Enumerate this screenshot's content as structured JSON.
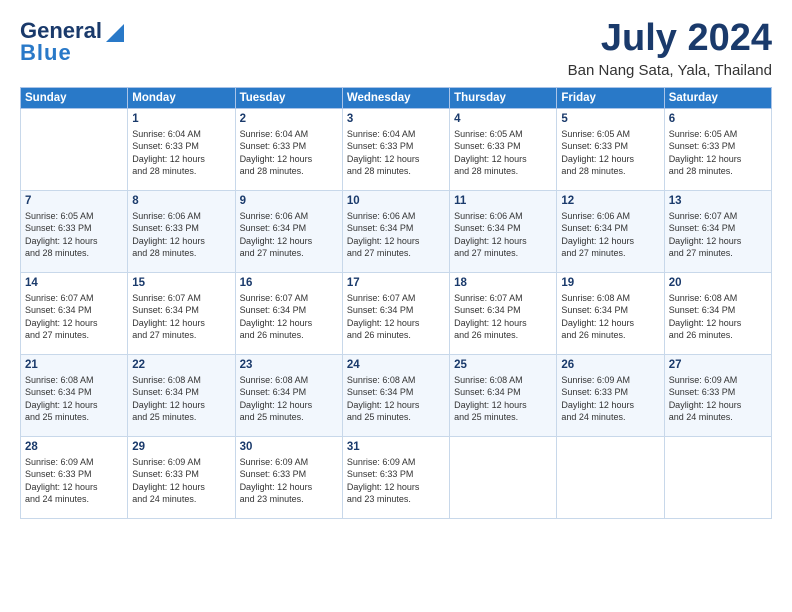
{
  "header": {
    "logo_general": "General",
    "logo_blue": "Blue",
    "month_title": "July 2024",
    "location": "Ban Nang Sata, Yala, Thailand"
  },
  "days_of_week": [
    "Sunday",
    "Monday",
    "Tuesday",
    "Wednesday",
    "Thursday",
    "Friday",
    "Saturday"
  ],
  "weeks": [
    [
      {
        "day": "",
        "info": ""
      },
      {
        "day": "1",
        "info": "Sunrise: 6:04 AM\nSunset: 6:33 PM\nDaylight: 12 hours\nand 28 minutes."
      },
      {
        "day": "2",
        "info": "Sunrise: 6:04 AM\nSunset: 6:33 PM\nDaylight: 12 hours\nand 28 minutes."
      },
      {
        "day": "3",
        "info": "Sunrise: 6:04 AM\nSunset: 6:33 PM\nDaylight: 12 hours\nand 28 minutes."
      },
      {
        "day": "4",
        "info": "Sunrise: 6:05 AM\nSunset: 6:33 PM\nDaylight: 12 hours\nand 28 minutes."
      },
      {
        "day": "5",
        "info": "Sunrise: 6:05 AM\nSunset: 6:33 PM\nDaylight: 12 hours\nand 28 minutes."
      },
      {
        "day": "6",
        "info": "Sunrise: 6:05 AM\nSunset: 6:33 PM\nDaylight: 12 hours\nand 28 minutes."
      }
    ],
    [
      {
        "day": "7",
        "info": "Sunrise: 6:05 AM\nSunset: 6:33 PM\nDaylight: 12 hours\nand 28 minutes."
      },
      {
        "day": "8",
        "info": "Sunrise: 6:06 AM\nSunset: 6:33 PM\nDaylight: 12 hours\nand 28 minutes."
      },
      {
        "day": "9",
        "info": "Sunrise: 6:06 AM\nSunset: 6:34 PM\nDaylight: 12 hours\nand 27 minutes."
      },
      {
        "day": "10",
        "info": "Sunrise: 6:06 AM\nSunset: 6:34 PM\nDaylight: 12 hours\nand 27 minutes."
      },
      {
        "day": "11",
        "info": "Sunrise: 6:06 AM\nSunset: 6:34 PM\nDaylight: 12 hours\nand 27 minutes."
      },
      {
        "day": "12",
        "info": "Sunrise: 6:06 AM\nSunset: 6:34 PM\nDaylight: 12 hours\nand 27 minutes."
      },
      {
        "day": "13",
        "info": "Sunrise: 6:07 AM\nSunset: 6:34 PM\nDaylight: 12 hours\nand 27 minutes."
      }
    ],
    [
      {
        "day": "14",
        "info": "Sunrise: 6:07 AM\nSunset: 6:34 PM\nDaylight: 12 hours\nand 27 minutes."
      },
      {
        "day": "15",
        "info": "Sunrise: 6:07 AM\nSunset: 6:34 PM\nDaylight: 12 hours\nand 27 minutes."
      },
      {
        "day": "16",
        "info": "Sunrise: 6:07 AM\nSunset: 6:34 PM\nDaylight: 12 hours\nand 26 minutes."
      },
      {
        "day": "17",
        "info": "Sunrise: 6:07 AM\nSunset: 6:34 PM\nDaylight: 12 hours\nand 26 minutes."
      },
      {
        "day": "18",
        "info": "Sunrise: 6:07 AM\nSunset: 6:34 PM\nDaylight: 12 hours\nand 26 minutes."
      },
      {
        "day": "19",
        "info": "Sunrise: 6:08 AM\nSunset: 6:34 PM\nDaylight: 12 hours\nand 26 minutes."
      },
      {
        "day": "20",
        "info": "Sunrise: 6:08 AM\nSunset: 6:34 PM\nDaylight: 12 hours\nand 26 minutes."
      }
    ],
    [
      {
        "day": "21",
        "info": "Sunrise: 6:08 AM\nSunset: 6:34 PM\nDaylight: 12 hours\nand 25 minutes."
      },
      {
        "day": "22",
        "info": "Sunrise: 6:08 AM\nSunset: 6:34 PM\nDaylight: 12 hours\nand 25 minutes."
      },
      {
        "day": "23",
        "info": "Sunrise: 6:08 AM\nSunset: 6:34 PM\nDaylight: 12 hours\nand 25 minutes."
      },
      {
        "day": "24",
        "info": "Sunrise: 6:08 AM\nSunset: 6:34 PM\nDaylight: 12 hours\nand 25 minutes."
      },
      {
        "day": "25",
        "info": "Sunrise: 6:08 AM\nSunset: 6:34 PM\nDaylight: 12 hours\nand 25 minutes."
      },
      {
        "day": "26",
        "info": "Sunrise: 6:09 AM\nSunset: 6:33 PM\nDaylight: 12 hours\nand 24 minutes."
      },
      {
        "day": "27",
        "info": "Sunrise: 6:09 AM\nSunset: 6:33 PM\nDaylight: 12 hours\nand 24 minutes."
      }
    ],
    [
      {
        "day": "28",
        "info": "Sunrise: 6:09 AM\nSunset: 6:33 PM\nDaylight: 12 hours\nand 24 minutes."
      },
      {
        "day": "29",
        "info": "Sunrise: 6:09 AM\nSunset: 6:33 PM\nDaylight: 12 hours\nand 24 minutes."
      },
      {
        "day": "30",
        "info": "Sunrise: 6:09 AM\nSunset: 6:33 PM\nDaylight: 12 hours\nand 23 minutes."
      },
      {
        "day": "31",
        "info": "Sunrise: 6:09 AM\nSunset: 6:33 PM\nDaylight: 12 hours\nand 23 minutes."
      },
      {
        "day": "",
        "info": ""
      },
      {
        "day": "",
        "info": ""
      },
      {
        "day": "",
        "info": ""
      }
    ]
  ]
}
